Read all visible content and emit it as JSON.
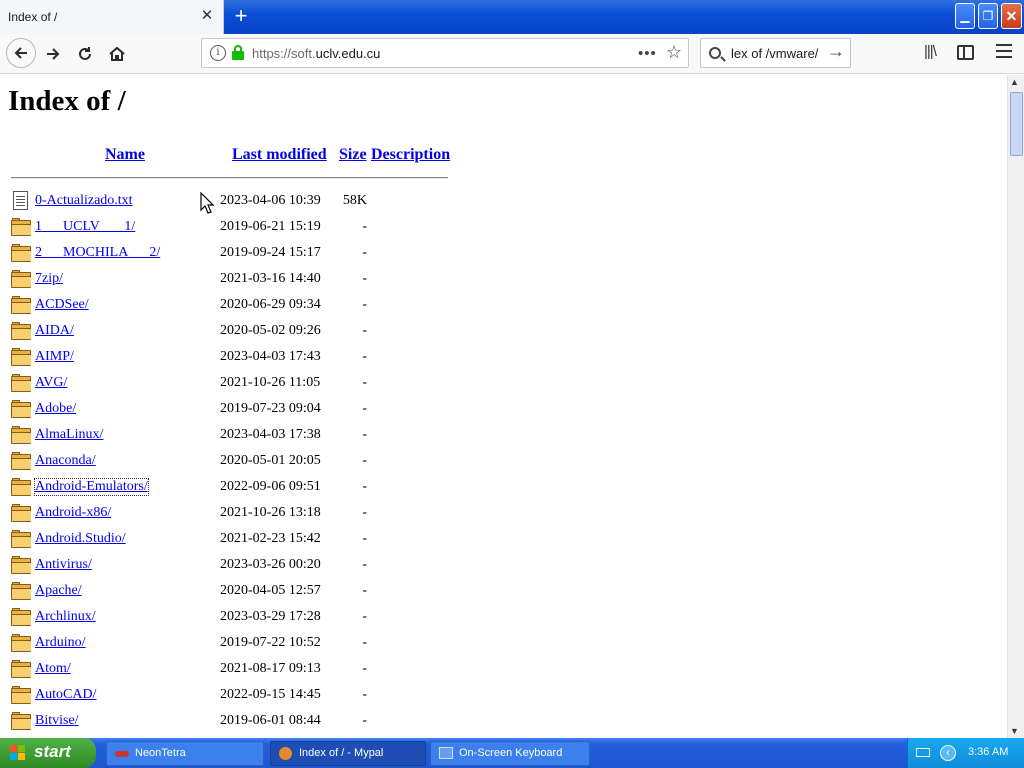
{
  "browser": {
    "tab_title": "Index of /",
    "url_scheme": "https://soft.",
    "url_host": "uclv.edu.cu",
    "search_text": "lex of /vmware/",
    "page_actions_glyph": "•••",
    "new_tab_glyph": "+"
  },
  "page": {
    "title": "Index of /",
    "headers": {
      "name": "Name",
      "last_modified": "Last modified",
      "size": "Size",
      "description": "Description"
    },
    "entries": [
      {
        "name": "0-Actualizado.txt",
        "modified": "2023-04-06 10:39",
        "size": "58K",
        "type": "file"
      },
      {
        "name": "1      UCLV       1/",
        "modified": "2019-06-21 15:19",
        "size": "-",
        "type": "folder"
      },
      {
        "name": "2      MOCHILA      2/",
        "modified": "2019-09-24 15:17",
        "size": "-",
        "type": "folder"
      },
      {
        "name": "7zip/",
        "modified": "2021-03-16 14:40",
        "size": "-",
        "type": "folder"
      },
      {
        "name": "ACDSee/",
        "modified": "2020-06-29 09:34",
        "size": "-",
        "type": "folder"
      },
      {
        "name": "AIDA/",
        "modified": "2020-05-02 09:26",
        "size": "-",
        "type": "folder"
      },
      {
        "name": "AIMP/",
        "modified": "2023-04-03 17:43",
        "size": "-",
        "type": "folder"
      },
      {
        "name": "AVG/",
        "modified": "2021-10-26 11:05",
        "size": "-",
        "type": "folder"
      },
      {
        "name": "Adobe/",
        "modified": "2019-07-23 09:04",
        "size": "-",
        "type": "folder"
      },
      {
        "name": "AlmaLinux/",
        "modified": "2023-04-03 17:38",
        "size": "-",
        "type": "folder"
      },
      {
        "name": "Anaconda/",
        "modified": "2020-05-01 20:05",
        "size": "-",
        "type": "folder"
      },
      {
        "name": "Android-Emulators/",
        "modified": "2022-09-06 09:51",
        "size": "-",
        "type": "folder",
        "focused": true
      },
      {
        "name": "Android-x86/",
        "modified": "2021-10-26 13:18",
        "size": "-",
        "type": "folder"
      },
      {
        "name": "Android.Studio/",
        "modified": "2021-02-23 15:42",
        "size": "-",
        "type": "folder"
      },
      {
        "name": "Antivirus/",
        "modified": "2023-03-26 00:20",
        "size": "-",
        "type": "folder"
      },
      {
        "name": "Apache/",
        "modified": "2020-04-05 12:57",
        "size": "-",
        "type": "folder"
      },
      {
        "name": "Archlinux/",
        "modified": "2023-03-29 17:28",
        "size": "-",
        "type": "folder"
      },
      {
        "name": "Arduino/",
        "modified": "2019-07-22 10:52",
        "size": "-",
        "type": "folder"
      },
      {
        "name": "Atom/",
        "modified": "2021-08-17 09:13",
        "size": "-",
        "type": "folder"
      },
      {
        "name": "AutoCAD/",
        "modified": "2022-09-15 14:45",
        "size": "-",
        "type": "folder"
      },
      {
        "name": "Bitvise/",
        "modified": "2019-06-01 08:44",
        "size": "-",
        "type": "folder"
      }
    ]
  },
  "taskbar": {
    "start_label": "start",
    "tasks": [
      {
        "label": "NeonTetra",
        "icon": "app-icon"
      },
      {
        "label": "Index of / - Mypal",
        "icon": "browser-icon",
        "active": true
      },
      {
        "label": "On-Screen Keyboard",
        "icon": "keyboard-icon"
      }
    ],
    "clock": "3:36 AM"
  },
  "colors": {
    "link": "#0000ee",
    "titlebar": "#0a4fd6",
    "taskbar": "#245edb",
    "start_button": "#3c9a32",
    "lock": "#12bc00"
  }
}
